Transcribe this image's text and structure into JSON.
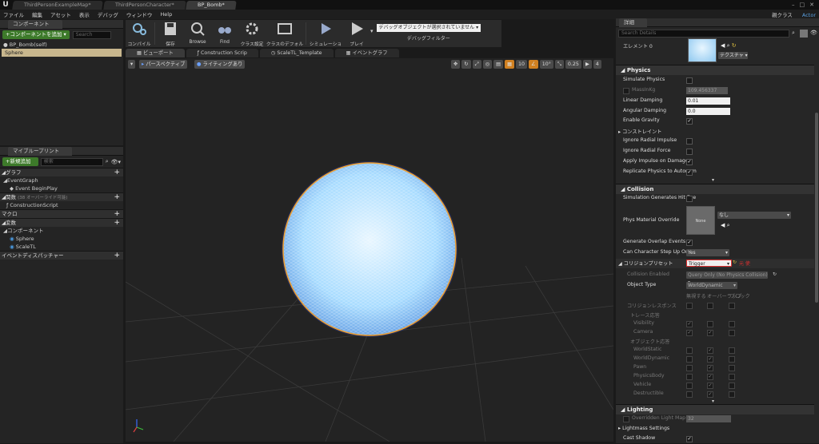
{
  "titlebar": {
    "logo": "U",
    "tabs": [
      "ThirdPersonExampleMap*",
      "ThirdPersonCharacter*",
      "BP_Bomb*"
    ],
    "active_tab": 2,
    "window_buttons": [
      "–",
      "□",
      "✕"
    ]
  },
  "menubar": {
    "items": [
      "ファイル",
      "編集",
      "アセット",
      "表示",
      "デバッグ",
      "ウィンドウ",
      "Help"
    ],
    "parent_class_label": "親クラス",
    "parent_class_value": "Actor"
  },
  "components_panel": {
    "tab": "コンポーネント",
    "add_button": "+コンポーネントを追加 ▾",
    "search_placeholder": "Search",
    "self_item": "BP_Bomb(self)",
    "items": [
      "Sphere"
    ]
  },
  "myblueprint_panel": {
    "tab": "マイブループリント",
    "add_button": "+新規追加 ▾",
    "search_placeholder": "検索",
    "sections": {
      "graph": "グラフ",
      "event_graph": "EventGraph",
      "event_begin_play": "Event BeginPlay",
      "functions": "関数",
      "functions_note": "(38 オーバーライド可能)",
      "construction_script": "ConstructionScript",
      "macros": "マクロ",
      "variables": "変数",
      "components": "コンポーネント",
      "comp_sphere": "Sphere",
      "comp_scale": "ScaleTL",
      "event_dispatchers": "イベントディスパッチャー"
    }
  },
  "toolbar": {
    "buttons": [
      "コンパイル",
      "保存",
      "Browse",
      "Find",
      "クラス設定",
      "クラスのデフォルト",
      "シミュレーション",
      "プレイ"
    ],
    "debug_object": "デバッグオブジェクトが選択されていません ▾",
    "debug_filter": "デバッグフィルター"
  },
  "viewport_tabs": [
    "ビューポート",
    "Construction Scrip",
    "ScaleTL_Template",
    "イベントグラフ"
  ],
  "viewport": {
    "perspective": "パースペクティブ",
    "lighting": "ライティングあり",
    "grid_snap": "10",
    "rot_snap": "10°",
    "scale_snap": "0.25",
    "cam_speed": "4"
  },
  "details": {
    "tab": "詳細",
    "search_placeholder": "Search Details",
    "element_label": "エレメント 0",
    "texture_label": "テクスチャ ▾",
    "physics": {
      "title": "Physics",
      "simulate": "Simulate Physics",
      "mass": "MassInKg",
      "mass_val": "109.456337",
      "linear_damping": "Linear Damping",
      "linear_val": "0.01",
      "angular_damping": "Angular Damping",
      "angular_val": "0.0",
      "enable_gravity": "Enable Gravity",
      "constraints": "コンストレイント",
      "ignore_radial_impulse": "Ignore Radial Impulse",
      "ignore_radial_force": "Ignore Radial Force",
      "apply_impulse": "Apply Impulse on Damage",
      "replicate": "Replicate Physics to Autonom"
    },
    "collision": {
      "title": "Collision",
      "sim_hit": "Simulation Generates Hit Eve",
      "phys_mat": "Phys Material Override",
      "phys_mat_none": "None",
      "phys_mat_val": "なし",
      "overlap": "Generate Overlap Events",
      "step_up": "Can Character Step Up On",
      "step_up_val": "Yes",
      "preset": "コリジョンプリセット",
      "preset_val": "Trigger",
      "preset_note": "元 使",
      "enabled": "Collision Enabled",
      "enabled_val": "Query Only (No Physics Collision)",
      "object_type": "Object Type",
      "object_type_val": "WorldDynamic",
      "col_ignore": "無視する",
      "col_overlap": "オーバーラップ",
      "col_block": "ブロック",
      "responses": "コリジョンレスポンス",
      "trace": "トレース応答",
      "visibility": "Visibility",
      "camera": "Camera",
      "object_resp": "オブジェクト応答",
      "world_static": "WorldStatic",
      "world_dynamic": "WorldDynamic",
      "pawn": "Pawn",
      "physics_body": "PhysicsBody",
      "vehicle": "Vehicle",
      "destructible": "Destructible"
    },
    "lighting": {
      "title": "Lighting",
      "overridden": "Overridden Light Map Re",
      "overridden_val": "32",
      "lightmass": "Lightmass Settings",
      "cast_shadow": "Cast Shadow"
    }
  },
  "colors": {
    "accent_green": "#3d7a2a",
    "selection": "#c8b78e",
    "sphere_fill": "#bfe8ff",
    "sphere_rim": "#f0a030"
  }
}
